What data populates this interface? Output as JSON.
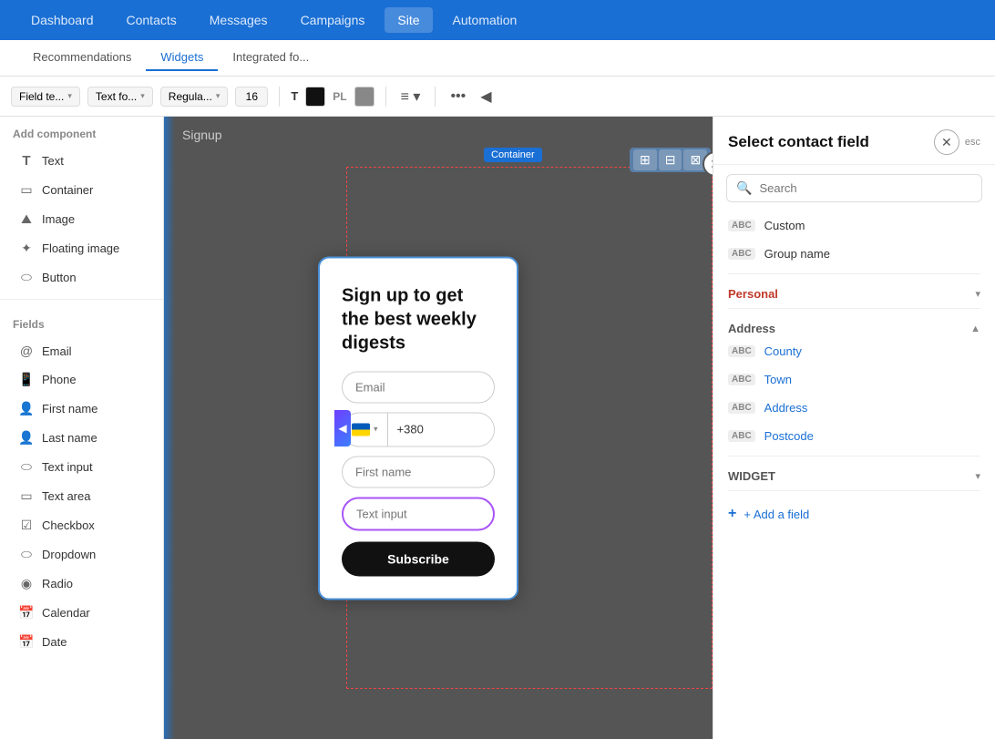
{
  "nav": {
    "items": [
      {
        "label": "Dashboard",
        "active": false
      },
      {
        "label": "Contacts",
        "active": false
      },
      {
        "label": "Messages",
        "active": false
      },
      {
        "label": "Campaigns",
        "active": false
      },
      {
        "label": "Site",
        "active": true
      },
      {
        "label": "Automation",
        "active": false
      }
    ]
  },
  "sub_nav": {
    "items": [
      {
        "label": "Recommendations",
        "active": false
      },
      {
        "label": "Widgets",
        "active": true
      },
      {
        "label": "Integrated fo...",
        "active": false
      }
    ]
  },
  "toolbar": {
    "field_type": "Field te...",
    "font": "Text fo...",
    "style": "Regula...",
    "size": "16",
    "text_color": "#111111",
    "placeholder_color": "#888888",
    "align": "≡"
  },
  "canvas": {
    "label": "Signup",
    "container_label": "Container"
  },
  "left_sidebar": {
    "section_components": "Add component",
    "components": [
      {
        "icon": "T",
        "label": "Text"
      },
      {
        "icon": "▭",
        "label": "Container"
      },
      {
        "icon": "🖼",
        "label": "Image"
      },
      {
        "icon": "⌂",
        "label": "Floating image"
      },
      {
        "icon": "⬭",
        "label": "Button"
      }
    ],
    "section_fields": "Fields",
    "fields": [
      {
        "icon": "@",
        "label": "Email"
      },
      {
        "icon": "📱",
        "label": "Phone"
      },
      {
        "icon": "👤",
        "label": "First name"
      },
      {
        "icon": "👤",
        "label": "Last name"
      },
      {
        "icon": "⬭",
        "label": "Text input"
      },
      {
        "icon": "▭",
        "label": "Text area"
      },
      {
        "icon": "☑",
        "label": "Checkbox"
      },
      {
        "icon": "⬭",
        "label": "Dropdown"
      },
      {
        "icon": "◉",
        "label": "Radio"
      },
      {
        "icon": "📅",
        "label": "Calendar"
      },
      {
        "icon": "📅",
        "label": "Date"
      }
    ]
  },
  "signup_card": {
    "title": "Sign up to get the best weekly digests",
    "email_placeholder": "Email",
    "phone_code": "+380",
    "firstname_placeholder": "First name",
    "textinput_placeholder": "Text input",
    "subscribe_label": "Subscribe"
  },
  "right_panel": {
    "title": "Select contact field",
    "close_label": "✕",
    "esc_label": "esc",
    "search_placeholder": "Search",
    "custom_label": "Custom",
    "group_name_label": "Group name",
    "personal_section": "Personal",
    "address_section": "Address",
    "widget_section": "WIDGET",
    "address_fields": [
      {
        "label": "County"
      },
      {
        "label": "Town"
      },
      {
        "label": "Address"
      },
      {
        "label": "Postcode"
      }
    ],
    "add_field_label": "+ Add a field"
  }
}
